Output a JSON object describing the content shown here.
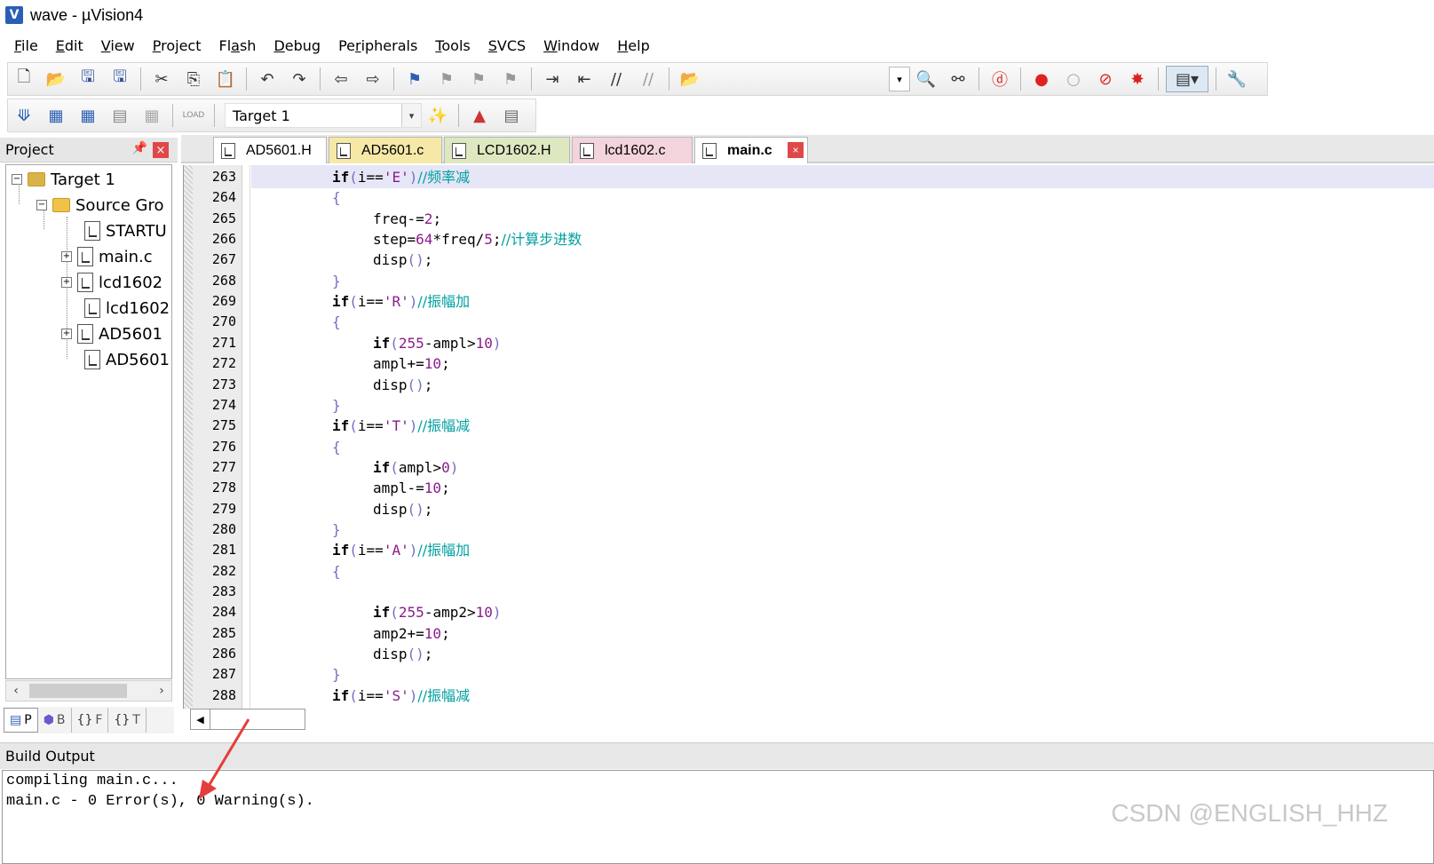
{
  "window": {
    "title": "wave  - µVision4",
    "app_icon": "V"
  },
  "menu": [
    {
      "pre": "",
      "ul": "F",
      "post": "ile"
    },
    {
      "pre": "",
      "ul": "E",
      "post": "dit"
    },
    {
      "pre": "",
      "ul": "V",
      "post": "iew"
    },
    {
      "pre": "",
      "ul": "P",
      "post": "roject"
    },
    {
      "pre": "Fl",
      "ul": "a",
      "post": "sh"
    },
    {
      "pre": "",
      "ul": "D",
      "post": "ebug"
    },
    {
      "pre": "Pe",
      "ul": "r",
      "post": "ipherals"
    },
    {
      "pre": "",
      "ul": "T",
      "post": "ools"
    },
    {
      "pre": "",
      "ul": "S",
      "post": "VCS"
    },
    {
      "pre": "",
      "ul": "W",
      "post": "indow"
    },
    {
      "pre": "",
      "ul": "H",
      "post": "elp"
    }
  ],
  "toolbar2": {
    "target": "Target 1",
    "load_label": "LOAD"
  },
  "project": {
    "header": "Project",
    "tree": {
      "target": "Target 1",
      "group": "Source Gro",
      "files": [
        "STARTU",
        "main.c",
        "lcd1602",
        "lcd1602",
        "AD5601",
        "AD5601"
      ]
    },
    "tabs": [
      "P",
      "B",
      "F",
      "T"
    ]
  },
  "editor": {
    "tabs": [
      "AD5601.H",
      "AD5601.c",
      "LCD1602.H",
      "lcd1602.c",
      "main.c"
    ],
    "tab_colors": [
      "#ffffff",
      "#f6e9a8",
      "#dde8c0",
      "#f3d4dc",
      "#ffffff"
    ],
    "lines": [
      {
        "n": "263",
        "indent": 0,
        "parts": [
          [
            "kw",
            "if"
          ],
          [
            "br",
            "("
          ],
          [
            "",
            "i=="
          ],
          [
            "str",
            "'E'"
          ],
          [
            "br",
            ")"
          ],
          [
            "cm",
            "//频率减"
          ]
        ]
      },
      {
        "n": "264",
        "indent": 0,
        "parts": [
          [
            "br",
            "{"
          ]
        ]
      },
      {
        "n": "265",
        "indent": 1,
        "parts": [
          [
            "",
            "freq-="
          ],
          [
            "num",
            "2"
          ],
          [
            "",
            ";"
          ]
        ]
      },
      {
        "n": "266",
        "indent": 1,
        "parts": [
          [
            "",
            "step="
          ],
          [
            "num",
            "64"
          ],
          [
            "",
            "*freq/"
          ],
          [
            "num",
            "5"
          ],
          [
            "",
            ";"
          ],
          [
            "cm",
            "//计算步进数"
          ]
        ]
      },
      {
        "n": "267",
        "indent": 1,
        "parts": [
          [
            "",
            "disp"
          ],
          [
            "br",
            "()"
          ],
          [
            "",
            ";"
          ]
        ]
      },
      {
        "n": "268",
        "indent": 0,
        "parts": [
          [
            "br",
            "}"
          ]
        ]
      },
      {
        "n": "269",
        "indent": 0,
        "parts": [
          [
            "kw",
            "if"
          ],
          [
            "br",
            "("
          ],
          [
            "",
            "i=="
          ],
          [
            "str",
            "'R'"
          ],
          [
            "br",
            ")"
          ],
          [
            "cm",
            "//振幅加"
          ]
        ]
      },
      {
        "n": "270",
        "indent": 0,
        "parts": [
          [
            "br",
            "{"
          ]
        ]
      },
      {
        "n": "271",
        "indent": 1,
        "parts": [
          [
            "kw",
            "if"
          ],
          [
            "br",
            "("
          ],
          [
            "num",
            "255"
          ],
          [
            "",
            "-ampl>"
          ],
          [
            "num",
            "10"
          ],
          [
            "br",
            ")"
          ]
        ]
      },
      {
        "n": "272",
        "indent": 1,
        "parts": [
          [
            "",
            "ampl+="
          ],
          [
            "num",
            "10"
          ],
          [
            "",
            ";"
          ]
        ]
      },
      {
        "n": "273",
        "indent": 1,
        "parts": [
          [
            "",
            "disp"
          ],
          [
            "br",
            "()"
          ],
          [
            "",
            ";"
          ]
        ]
      },
      {
        "n": "274",
        "indent": 0,
        "parts": [
          [
            "br",
            "}"
          ]
        ]
      },
      {
        "n": "275",
        "indent": 0,
        "parts": [
          [
            "kw",
            "if"
          ],
          [
            "br",
            "("
          ],
          [
            "",
            "i=="
          ],
          [
            "str",
            "'T'"
          ],
          [
            "br",
            ")"
          ],
          [
            "cm",
            "//振幅减"
          ]
        ]
      },
      {
        "n": "276",
        "indent": 0,
        "parts": [
          [
            "br",
            "{"
          ]
        ]
      },
      {
        "n": "277",
        "indent": 1,
        "parts": [
          [
            "kw",
            "if"
          ],
          [
            "br",
            "("
          ],
          [
            "",
            "ampl>"
          ],
          [
            "num",
            "0"
          ],
          [
            "br",
            ")"
          ]
        ]
      },
      {
        "n": "278",
        "indent": 1,
        "parts": [
          [
            "",
            "ampl-="
          ],
          [
            "num",
            "10"
          ],
          [
            "",
            ";"
          ]
        ]
      },
      {
        "n": "279",
        "indent": 1,
        "parts": [
          [
            "",
            "disp"
          ],
          [
            "br",
            "()"
          ],
          [
            "",
            ";"
          ]
        ]
      },
      {
        "n": "280",
        "indent": 0,
        "parts": [
          [
            "br",
            "}"
          ]
        ]
      },
      {
        "n": "281",
        "indent": 0,
        "parts": [
          [
            "kw",
            "if"
          ],
          [
            "br",
            "("
          ],
          [
            "",
            "i=="
          ],
          [
            "str",
            "'A'"
          ],
          [
            "br",
            ")"
          ],
          [
            "cm",
            "//振幅加"
          ]
        ]
      },
      {
        "n": "282",
        "indent": 0,
        "parts": [
          [
            "br",
            "{"
          ]
        ]
      },
      {
        "n": "283",
        "indent": 0,
        "parts": []
      },
      {
        "n": "284",
        "indent": 1,
        "parts": [
          [
            "kw",
            "if"
          ],
          [
            "br",
            "("
          ],
          [
            "num",
            "255"
          ],
          [
            "",
            "-amp2>"
          ],
          [
            "num",
            "10"
          ],
          [
            "br",
            ")"
          ]
        ]
      },
      {
        "n": "285",
        "indent": 1,
        "parts": [
          [
            "",
            "amp2+="
          ],
          [
            "num",
            "10"
          ],
          [
            "",
            ";"
          ]
        ]
      },
      {
        "n": "286",
        "indent": 1,
        "parts": [
          [
            "",
            "disp"
          ],
          [
            "br",
            "()"
          ],
          [
            "",
            ";"
          ]
        ]
      },
      {
        "n": "287",
        "indent": 0,
        "parts": [
          [
            "br",
            "}"
          ]
        ]
      },
      {
        "n": "288",
        "indent": 0,
        "parts": [
          [
            "kw",
            "if"
          ],
          [
            "br",
            "("
          ],
          [
            "",
            "i=="
          ],
          [
            "str",
            "'S'"
          ],
          [
            "br",
            ")"
          ],
          [
            "cm",
            "//振幅减"
          ]
        ]
      }
    ]
  },
  "build": {
    "header": "Build Output",
    "lines": [
      "compiling main.c...",
      "main.c - 0 Error(s), 0 Warning(s)."
    ]
  },
  "watermark": "CSDN @ENGLISH_HHZ",
  "colors": {
    "accent_red": "#e63c3c",
    "highlight_line": "#e6e6f7",
    "comment": "#00a0a0",
    "string": "#8a1c8a"
  }
}
